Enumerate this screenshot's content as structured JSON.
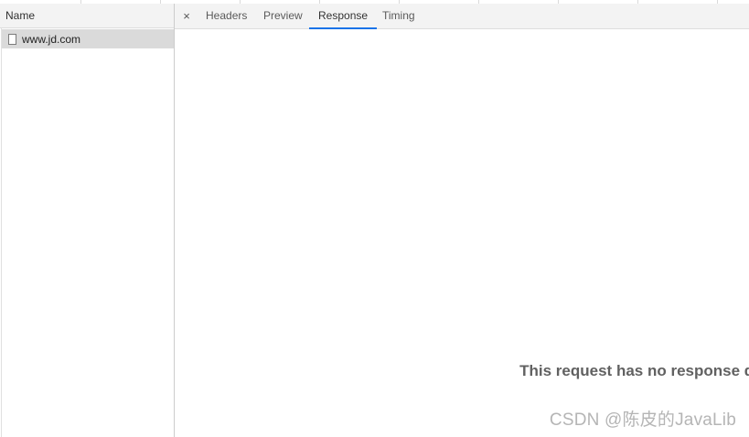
{
  "left_panel": {
    "column_header": "Name",
    "requests": [
      {
        "name": "www.jd.com",
        "icon": "document-icon"
      }
    ]
  },
  "detail_panel": {
    "close_icon": "×",
    "tabs": [
      {
        "label": "Headers",
        "active": false
      },
      {
        "label": "Preview",
        "active": false
      },
      {
        "label": "Response",
        "active": true
      },
      {
        "label": "Timing",
        "active": false
      }
    ],
    "empty_message": "This request has no response data available."
  },
  "watermark": "CSDN @陈皮的JavaLib",
  "colors": {
    "active_tab_underline": "#1a73e8",
    "selected_row_bg": "#dadada",
    "header_bg": "#f3f3f3"
  }
}
